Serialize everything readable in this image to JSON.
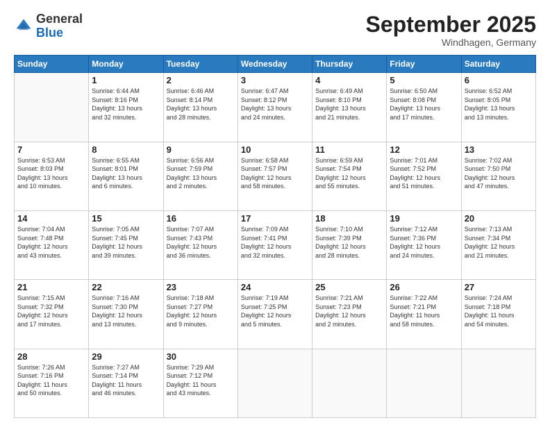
{
  "header": {
    "logo_general": "General",
    "logo_blue": "Blue",
    "month": "September 2025",
    "location": "Windhagen, Germany"
  },
  "days_of_week": [
    "Sunday",
    "Monday",
    "Tuesday",
    "Wednesday",
    "Thursday",
    "Friday",
    "Saturday"
  ],
  "weeks": [
    [
      {
        "day": "",
        "info": ""
      },
      {
        "day": "1",
        "info": "Sunrise: 6:44 AM\nSunset: 8:16 PM\nDaylight: 13 hours\nand 32 minutes."
      },
      {
        "day": "2",
        "info": "Sunrise: 6:46 AM\nSunset: 8:14 PM\nDaylight: 13 hours\nand 28 minutes."
      },
      {
        "day": "3",
        "info": "Sunrise: 6:47 AM\nSunset: 8:12 PM\nDaylight: 13 hours\nand 24 minutes."
      },
      {
        "day": "4",
        "info": "Sunrise: 6:49 AM\nSunset: 8:10 PM\nDaylight: 13 hours\nand 21 minutes."
      },
      {
        "day": "5",
        "info": "Sunrise: 6:50 AM\nSunset: 8:08 PM\nDaylight: 13 hours\nand 17 minutes."
      },
      {
        "day": "6",
        "info": "Sunrise: 6:52 AM\nSunset: 8:05 PM\nDaylight: 13 hours\nand 13 minutes."
      }
    ],
    [
      {
        "day": "7",
        "info": "Sunrise: 6:53 AM\nSunset: 8:03 PM\nDaylight: 13 hours\nand 10 minutes."
      },
      {
        "day": "8",
        "info": "Sunrise: 6:55 AM\nSunset: 8:01 PM\nDaylight: 13 hours\nand 6 minutes."
      },
      {
        "day": "9",
        "info": "Sunrise: 6:56 AM\nSunset: 7:59 PM\nDaylight: 13 hours\nand 2 minutes."
      },
      {
        "day": "10",
        "info": "Sunrise: 6:58 AM\nSunset: 7:57 PM\nDaylight: 12 hours\nand 58 minutes."
      },
      {
        "day": "11",
        "info": "Sunrise: 6:59 AM\nSunset: 7:54 PM\nDaylight: 12 hours\nand 55 minutes."
      },
      {
        "day": "12",
        "info": "Sunrise: 7:01 AM\nSunset: 7:52 PM\nDaylight: 12 hours\nand 51 minutes."
      },
      {
        "day": "13",
        "info": "Sunrise: 7:02 AM\nSunset: 7:50 PM\nDaylight: 12 hours\nand 47 minutes."
      }
    ],
    [
      {
        "day": "14",
        "info": "Sunrise: 7:04 AM\nSunset: 7:48 PM\nDaylight: 12 hours\nand 43 minutes."
      },
      {
        "day": "15",
        "info": "Sunrise: 7:05 AM\nSunset: 7:45 PM\nDaylight: 12 hours\nand 39 minutes."
      },
      {
        "day": "16",
        "info": "Sunrise: 7:07 AM\nSunset: 7:43 PM\nDaylight: 12 hours\nand 36 minutes."
      },
      {
        "day": "17",
        "info": "Sunrise: 7:09 AM\nSunset: 7:41 PM\nDaylight: 12 hours\nand 32 minutes."
      },
      {
        "day": "18",
        "info": "Sunrise: 7:10 AM\nSunset: 7:39 PM\nDaylight: 12 hours\nand 28 minutes."
      },
      {
        "day": "19",
        "info": "Sunrise: 7:12 AM\nSunset: 7:36 PM\nDaylight: 12 hours\nand 24 minutes."
      },
      {
        "day": "20",
        "info": "Sunrise: 7:13 AM\nSunset: 7:34 PM\nDaylight: 12 hours\nand 21 minutes."
      }
    ],
    [
      {
        "day": "21",
        "info": "Sunrise: 7:15 AM\nSunset: 7:32 PM\nDaylight: 12 hours\nand 17 minutes."
      },
      {
        "day": "22",
        "info": "Sunrise: 7:16 AM\nSunset: 7:30 PM\nDaylight: 12 hours\nand 13 minutes."
      },
      {
        "day": "23",
        "info": "Sunrise: 7:18 AM\nSunset: 7:27 PM\nDaylight: 12 hours\nand 9 minutes."
      },
      {
        "day": "24",
        "info": "Sunrise: 7:19 AM\nSunset: 7:25 PM\nDaylight: 12 hours\nand 5 minutes."
      },
      {
        "day": "25",
        "info": "Sunrise: 7:21 AM\nSunset: 7:23 PM\nDaylight: 12 hours\nand 2 minutes."
      },
      {
        "day": "26",
        "info": "Sunrise: 7:22 AM\nSunset: 7:21 PM\nDaylight: 11 hours\nand 58 minutes."
      },
      {
        "day": "27",
        "info": "Sunrise: 7:24 AM\nSunset: 7:18 PM\nDaylight: 11 hours\nand 54 minutes."
      }
    ],
    [
      {
        "day": "28",
        "info": "Sunrise: 7:26 AM\nSunset: 7:16 PM\nDaylight: 11 hours\nand 50 minutes."
      },
      {
        "day": "29",
        "info": "Sunrise: 7:27 AM\nSunset: 7:14 PM\nDaylight: 11 hours\nand 46 minutes."
      },
      {
        "day": "30",
        "info": "Sunrise: 7:29 AM\nSunset: 7:12 PM\nDaylight: 11 hours\nand 43 minutes."
      },
      {
        "day": "",
        "info": ""
      },
      {
        "day": "",
        "info": ""
      },
      {
        "day": "",
        "info": ""
      },
      {
        "day": "",
        "info": ""
      }
    ]
  ]
}
